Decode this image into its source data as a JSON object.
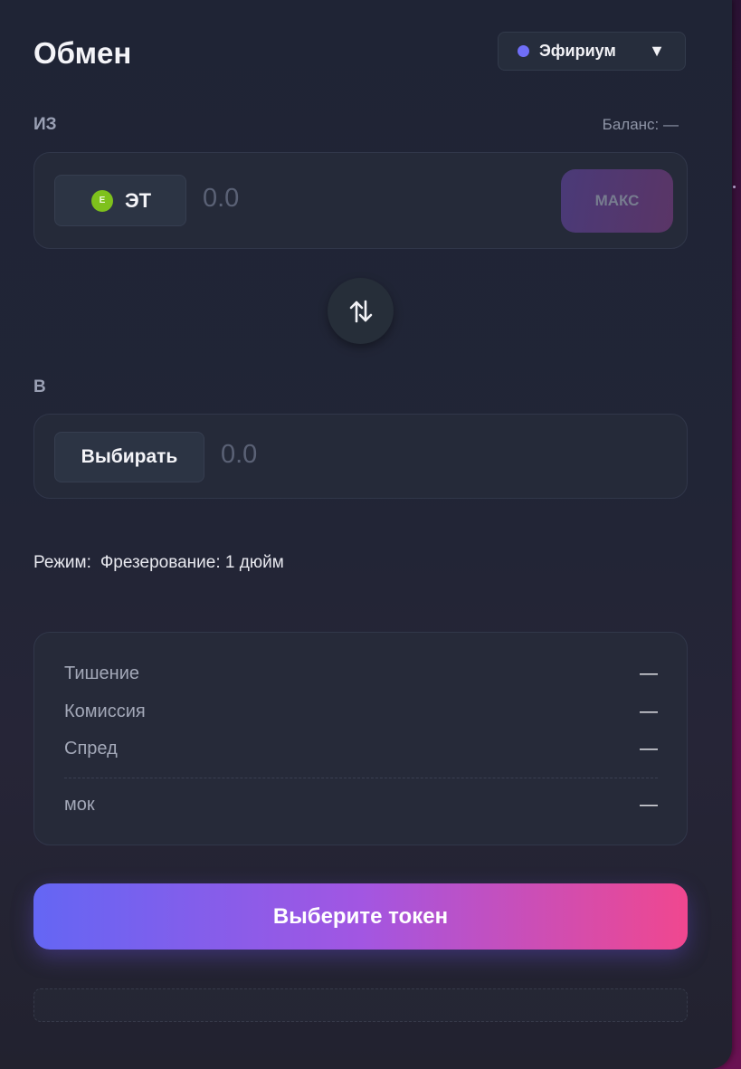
{
  "header": {
    "title": "Обмен",
    "network": {
      "label": "Эфириум",
      "dot_color": "#6f6ef7",
      "caret": "▼"
    }
  },
  "from": {
    "label": "ИЗ",
    "balance": "Баланс: —",
    "token": {
      "symbol": "ЭТ",
      "icon_letter": "E",
      "icon_color": "#7ec11c"
    },
    "amount_placeholder": "0.0",
    "max_label": "МАКС"
  },
  "swap_icon": "swap-arrows-icon",
  "to": {
    "label": "В",
    "select_label": "Выбирать",
    "amount_placeholder": "0.0"
  },
  "mode": {
    "label": "Режим:",
    "value": "Фрезерование: 1 дюйм"
  },
  "details": {
    "rows": [
      {
        "label": "Тишение",
        "value": "—"
      },
      {
        "label": "Комиссия",
        "value": "—"
      },
      {
        "label": "Спред",
        "value": "—"
      }
    ],
    "footer": {
      "label": "мок",
      "value": "—"
    }
  },
  "cta": {
    "label": "Выберите токен",
    "gradient": [
      "#6466f4",
      "#a256e2",
      "#f0478f"
    ]
  }
}
